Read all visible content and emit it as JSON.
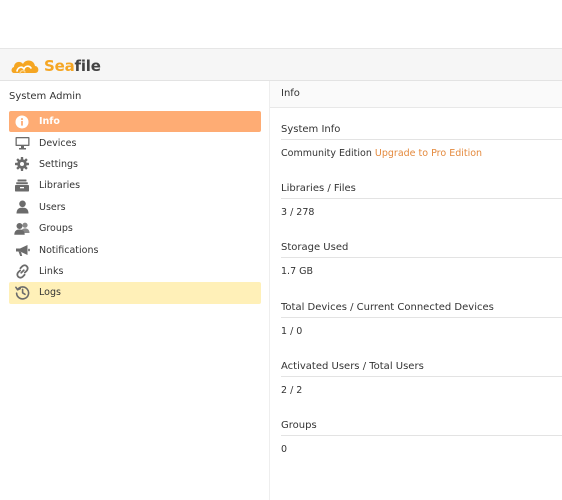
{
  "brand": {
    "logo_part1": "Sea",
    "logo_part2": "file",
    "accent_color": "#f5a623"
  },
  "sidebar": {
    "title": "System Admin",
    "items": [
      {
        "label": "Info",
        "icon": "info-icon",
        "state": "active"
      },
      {
        "label": "Devices",
        "icon": "monitor-icon",
        "state": "normal"
      },
      {
        "label": "Settings",
        "icon": "gear-icon",
        "state": "normal"
      },
      {
        "label": "Libraries",
        "icon": "library-icon",
        "state": "normal"
      },
      {
        "label": "Users",
        "icon": "user-icon",
        "state": "normal"
      },
      {
        "label": "Groups",
        "icon": "group-icon",
        "state": "normal"
      },
      {
        "label": "Notifications",
        "icon": "megaphone-icon",
        "state": "normal"
      },
      {
        "label": "Links",
        "icon": "link-icon",
        "state": "normal"
      },
      {
        "label": "Logs",
        "icon": "history-icon",
        "state": "hover"
      }
    ],
    "active_color": "#feac74",
    "hover_color": "#fff0b8"
  },
  "main": {
    "title": "Info",
    "sections": [
      {
        "title": "System Info",
        "value": "Community Edition",
        "link": "Upgrade to Pro Edition"
      },
      {
        "title": "Libraries / Files",
        "value": "3 / 278"
      },
      {
        "title": "Storage Used",
        "value": "1.7 GB"
      },
      {
        "title": "Total Devices / Current Connected Devices",
        "value": "1 / 0"
      },
      {
        "title": "Activated Users / Total Users",
        "value": "2 / 2"
      },
      {
        "title": "Groups",
        "value": "0"
      }
    ]
  }
}
